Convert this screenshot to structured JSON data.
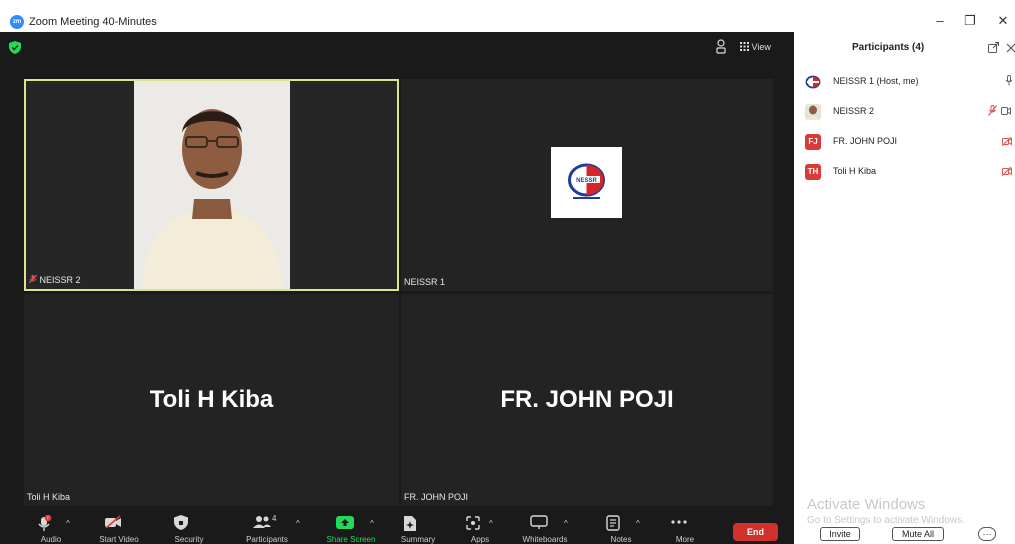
{
  "window": {
    "title": "Zoom Meeting 40-Minutes",
    "logo_text": "zm",
    "minimize": "–",
    "restore": "❐",
    "close": "✕"
  },
  "meeting": {
    "view_label": "View",
    "tiles": [
      {
        "id": "neissr2",
        "name": "NEISSR 2",
        "muted": true,
        "active_speaker": true
      },
      {
        "id": "neissr1",
        "name": "NEISSR 1",
        "logo_text": "NESSR"
      },
      {
        "id": "toli",
        "name": "Toli H Kiba",
        "display_name": "Toli H Kiba"
      },
      {
        "id": "john",
        "name": "FR. JOHN POJI",
        "display_name": "FR. JOHN POJI"
      }
    ]
  },
  "toolbar": {
    "audio": "Audio",
    "start_video": "Start Video",
    "security": "Security",
    "participants": "Participants",
    "participants_count": "4",
    "share_screen": "Share Screen",
    "summary": "Summary",
    "apps": "Apps",
    "whiteboards": "Whiteboards",
    "notes": "Notes",
    "more": "More",
    "end": "End"
  },
  "panel": {
    "title": "Participants (4)",
    "participants": [
      {
        "name": "NEISSR 1 (Host, me)",
        "avatar": "logo"
      },
      {
        "name": "NEISSR 2",
        "avatar": "photo"
      },
      {
        "name": "FR. JOHN POJI",
        "avatar": "FJ",
        "color": "#d93b3b"
      },
      {
        "name": "Toli H Kiba",
        "avatar": "TH",
        "color": "#d93b3b"
      }
    ],
    "activate_title": "Activate Windows",
    "activate_sub": "Go to Settings to activate Windows.",
    "invite": "Invite",
    "mute_all": "Mute All",
    "more": "···"
  },
  "colors": {
    "accent_green": "#23d959",
    "end_red": "#d0312d",
    "speaker_border": "#dbe48f"
  }
}
